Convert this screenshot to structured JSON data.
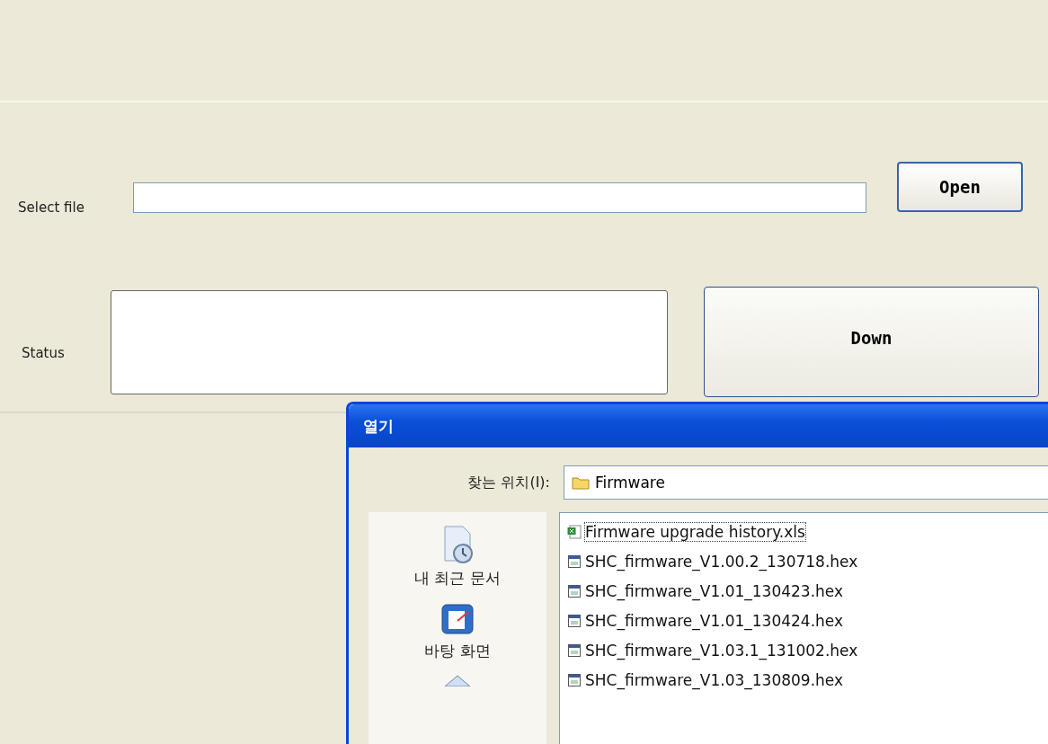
{
  "form": {
    "file_label": "Select file",
    "open_button": "Open",
    "status_label": "Status",
    "down_button": "Down"
  },
  "dialog": {
    "title": "열기",
    "look_in_label": "찾는 위치(I):",
    "look_in_value": "Firmware",
    "places": [
      {
        "kind": "recent",
        "label": "내 최근 문서"
      },
      {
        "kind": "desktop",
        "label": "바탕 화면"
      },
      {
        "kind": "documents"
      }
    ],
    "files": [
      {
        "kind": "spreadsheet",
        "name": "Firmware upgrade history.xls",
        "focused": true
      },
      {
        "kind": "hex",
        "name": "SHC_firmware_V1.00.2_130718.hex",
        "focused": false
      },
      {
        "kind": "hex",
        "name": "SHC_firmware_V1.01_130423.hex",
        "focused": false
      },
      {
        "kind": "hex",
        "name": "SHC_firmware_V1.01_130424.hex",
        "focused": false
      },
      {
        "kind": "hex",
        "name": "SHC_firmware_V1.03.1_131002.hex",
        "focused": false
      },
      {
        "kind": "hex",
        "name": "SHC_firmware_V1.03_130809.hex",
        "focused": false
      }
    ]
  }
}
